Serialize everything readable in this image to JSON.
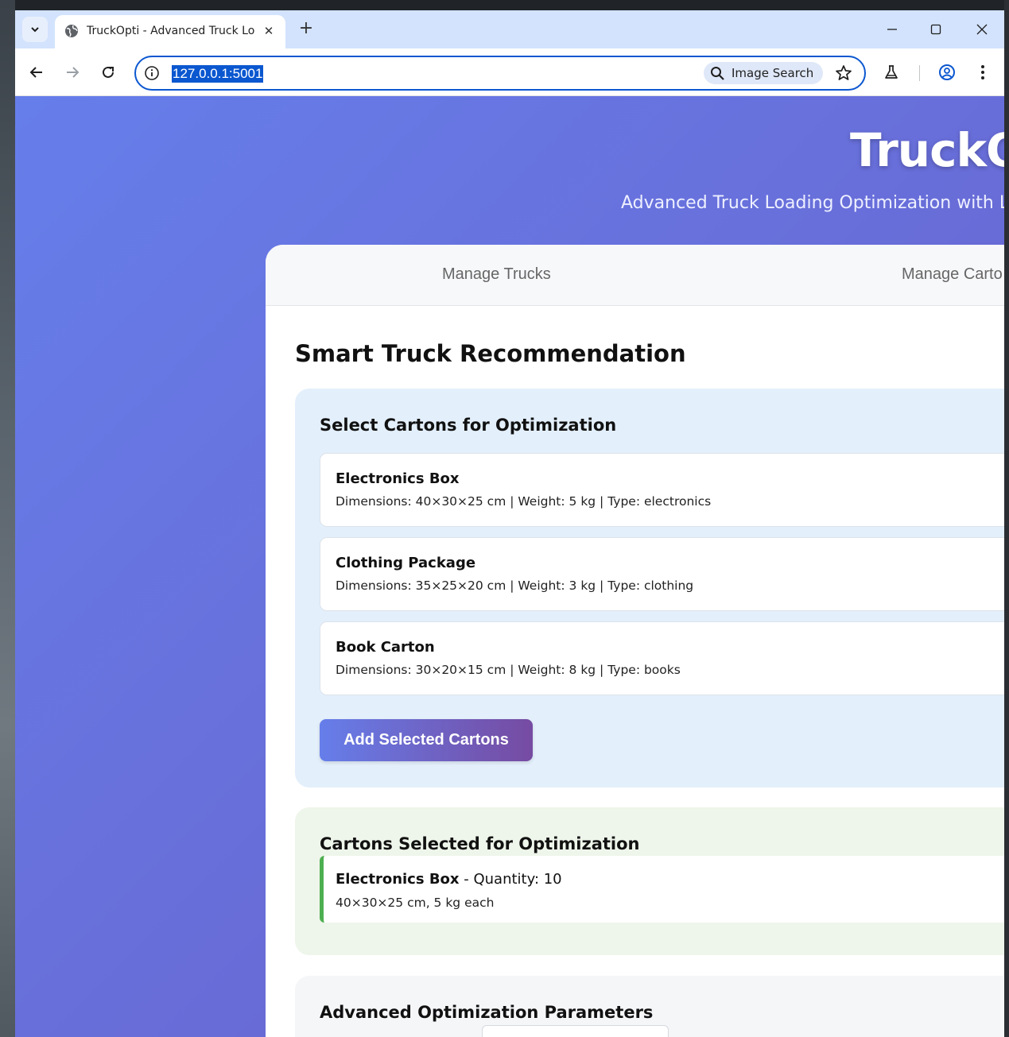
{
  "browser": {
    "tab_title": "TruckOpti - Advanced Truck Loa",
    "url": "127.0.0.1:5001",
    "image_search_label": "Image Search"
  },
  "hero": {
    "title": "TruckO",
    "subtitle": "Advanced Truck Loading Optimization with LA"
  },
  "nav": {
    "tabs": [
      {
        "label": "Manage Trucks"
      },
      {
        "label": "Manage Carto"
      }
    ]
  },
  "recommendation": {
    "title": "Smart Truck Recommendation",
    "select_heading": "Select Cartons for Optimization",
    "cartons": [
      {
        "name": "Electronics Box",
        "details": "Dimensions: 40×30×25 cm | Weight: 5 kg | Type: electronics"
      },
      {
        "name": "Clothing Package",
        "details": "Dimensions: 35×25×20 cm | Weight: 3 kg | Type: clothing"
      },
      {
        "name": "Book Carton",
        "details": "Dimensions: 30×20×15 cm | Weight: 8 kg | Type: books"
      }
    ],
    "add_button_label": "Add Selected Cartons",
    "selected_heading": "Cartons Selected for Optimization",
    "selected": [
      {
        "name": "Electronics Box",
        "quantity_text": " - Quantity: 10",
        "details": "40×30×25 cm, 5 kg each"
      }
    ],
    "advanced_heading": "Advanced Optimization Parameters"
  },
  "colors": {
    "accent": "#0b57d0",
    "gradient_start": "#667eea",
    "gradient_end": "#764ba2",
    "selected_border": "#4caf50"
  }
}
